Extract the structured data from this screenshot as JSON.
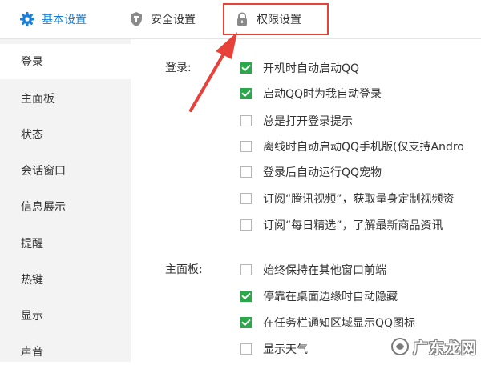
{
  "tabs": [
    {
      "label": "基本设置",
      "icon": "gear-icon"
    },
    {
      "label": "安全设置",
      "icon": "shield-icon"
    },
    {
      "label": "权限设置",
      "icon": "lock-icon"
    }
  ],
  "sidebar": {
    "items": [
      {
        "label": "登录"
      },
      {
        "label": "主面板"
      },
      {
        "label": "状态"
      },
      {
        "label": "会话窗口"
      },
      {
        "label": "信息展示"
      },
      {
        "label": "提醒"
      },
      {
        "label": "热键"
      },
      {
        "label": "显示"
      },
      {
        "label": "声音"
      }
    ]
  },
  "sections": {
    "login": {
      "label": "登录:",
      "options": [
        {
          "label": "开机时自动启动QQ",
          "checked": true
        },
        {
          "label": "启动QQ时为我自动登录",
          "checked": true
        },
        {
          "label": "总是打开登录提示",
          "checked": false
        },
        {
          "label": "离线时自动启动QQ手机版(仅支持Andro",
          "checked": false
        },
        {
          "label": "登录后自动运行QQ宠物",
          "checked": false
        },
        {
          "label": "订阅“腾讯视频”，获取量身定制视频资",
          "checked": false
        },
        {
          "label": "订阅“每日精选”，了解最新商品资讯",
          "checked": false
        }
      ]
    },
    "panel": {
      "label": "主面板:",
      "options": [
        {
          "label": "始终保持在其他窗口前端",
          "checked": false
        },
        {
          "label": "停靠在桌面边缘时自动隐藏",
          "checked": true
        },
        {
          "label": "在任务栏通知区域显示QQ图标",
          "checked": true
        },
        {
          "label": "显示天气",
          "checked": false
        }
      ]
    }
  },
  "watermark": {
    "text": "广东龙网"
  },
  "colors": {
    "accent": "#1a7fd6",
    "check_green": "#2aa84a",
    "annotation_red": "#e8413a",
    "sidebar_bg": "#f3f3f3"
  }
}
